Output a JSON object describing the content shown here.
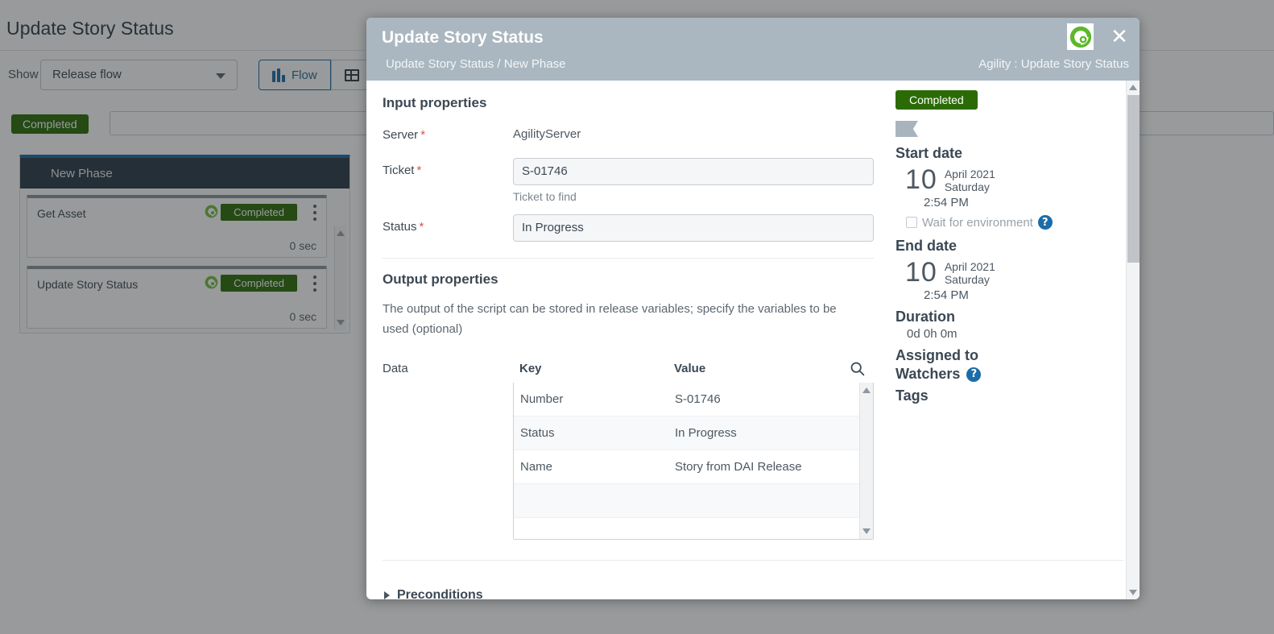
{
  "background": {
    "page_title": "Update Story Status",
    "toolbar": {
      "show_label": "Show",
      "show_selected": "Release flow",
      "tab_flow": "Flow",
      "tab_grid_icon": "grid-icon"
    },
    "status_filter_badge": "Completed",
    "search_placeholder": "",
    "phase": {
      "title": "New Phase",
      "tasks": [
        {
          "name": "Get Asset",
          "status": "Completed",
          "duration": "0 sec"
        },
        {
          "name": "Update Story Status",
          "status": "Completed",
          "duration": "0 sec"
        }
      ]
    }
  },
  "modal": {
    "title": "Update Story Status",
    "breadcrumb": "Update Story Status / New Phase",
    "context": "Agility : Update Story Status",
    "close_icon": "close-icon",
    "plugin_logo_icon": "agility-logo-icon",
    "input_section": {
      "heading": "Input properties",
      "server_label": "Server",
      "server_value": "AgilityServer",
      "ticket_label": "Ticket",
      "ticket_value": "S-01746",
      "ticket_help": "Ticket to find",
      "status_label": "Status",
      "status_value": "In Progress",
      "required_marker": "*"
    },
    "output_section": {
      "heading": "Output properties",
      "description": "The output of the script can be stored in release variables; specify the variables to be used (optional)",
      "data_label": "Data",
      "search_icon": "search-icon",
      "columns": [
        "Key",
        "Value"
      ],
      "rows": [
        {
          "key": "Number",
          "value": "S-01746"
        },
        {
          "key": "Status",
          "value": "In Progress"
        },
        {
          "key": "Name",
          "value": "Story from DAI Release"
        },
        {
          "key": "",
          "value": ""
        },
        {
          "key": "",
          "value": ""
        }
      ]
    },
    "preconditions_label": "Preconditions",
    "sidebar": {
      "status_badge": "Completed",
      "flag_icon": "flag-icon",
      "start_date_label": "Start date",
      "start_day": "10",
      "start_month_year": "April 2021",
      "start_weekday": "Saturday",
      "start_time": "2:54 PM",
      "wait_for_environment_label": "Wait for environment",
      "wait_help_icon": "help-icon",
      "end_date_label": "End date",
      "end_day": "10",
      "end_month_year": "April 2021",
      "end_weekday": "Saturday",
      "end_time": "2:54 PM",
      "duration_label": "Duration",
      "duration_value": "0d 0h 0m",
      "assigned_to_label": "Assigned to",
      "watchers_label": "Watchers",
      "watchers_help_icon": "help-icon",
      "tags_label": "Tags"
    }
  },
  "colors": {
    "status_green": "#2b6b06",
    "accent_blue": "#1b6ca8",
    "header_gray": "#aab7c0",
    "required_red": "#d9534f"
  }
}
